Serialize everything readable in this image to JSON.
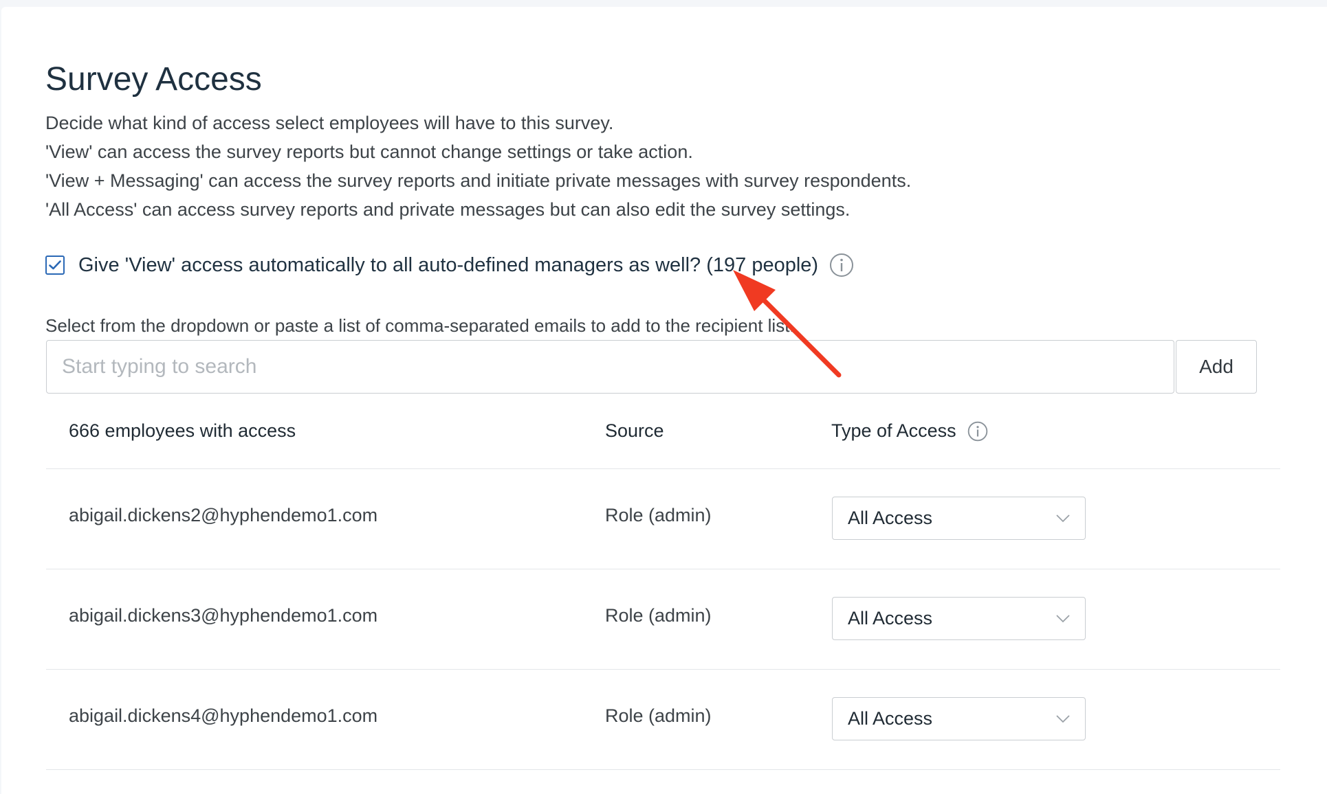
{
  "page": {
    "title": "Survey Access",
    "description": [
      "Decide what kind of access select employees will have to this survey.",
      "'View' can access the survey reports but cannot change settings or take action.",
      "'View + Messaging' can access the survey reports and initiate private messages with survey respondents.",
      "'All Access' can access survey reports and private messages but can also edit the survey settings."
    ]
  },
  "auto_manager_option": {
    "checked": true,
    "label": "Give 'View' access automatically to all auto-defined managers as well? (197 people)",
    "icon": "info-icon"
  },
  "recipient_search": {
    "helper_text": "Select from the dropdown or paste a list of comma-separated emails to add to the recipient list.",
    "placeholder": "Start typing to search",
    "value": "",
    "add_label": "Add"
  },
  "access_table": {
    "headers": {
      "email": "666 employees with access",
      "source": "Source",
      "access": "Type of Access"
    },
    "rows": [
      {
        "email": "abigail.dickens2@hyphendemo1.com",
        "source": "Role (admin)",
        "access": "All Access"
      },
      {
        "email": "abigail.dickens3@hyphendemo1.com",
        "source": "Role (admin)",
        "access": "All Access"
      },
      {
        "email": "abigail.dickens4@hyphendemo1.com",
        "source": "Role (admin)",
        "access": "All Access"
      }
    ]
  },
  "colors": {
    "accent": "#2a68b5",
    "annotation_arrow": "#f03a22",
    "title": "#1f3140"
  }
}
